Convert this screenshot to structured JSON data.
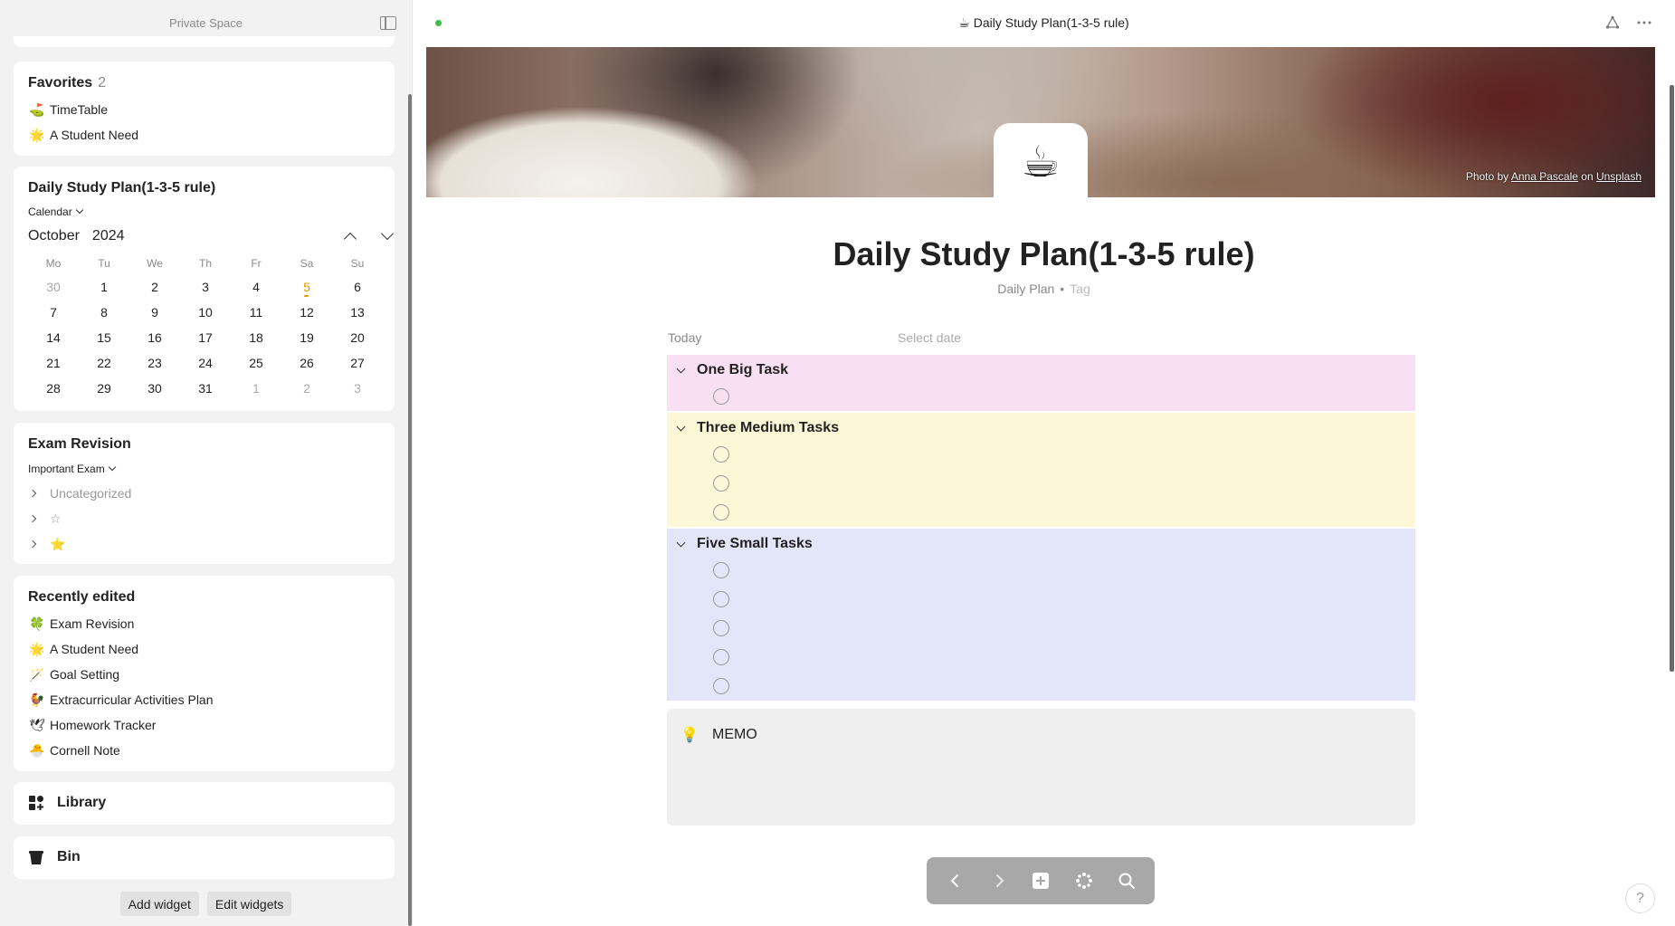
{
  "sidebar": {
    "space_name": "Private Space",
    "favorites": {
      "title": "Favorites",
      "count": "2",
      "items": [
        {
          "emoji": "⛳",
          "label": "TimeTable"
        },
        {
          "emoji": "🌟",
          "label": "A Student Need"
        }
      ]
    },
    "calendar_widget": {
      "title": "Daily Study Plan(1-3-5 rule)",
      "view": "Calendar",
      "month": "October",
      "year": "2024",
      "weekdays": [
        "Mo",
        "Tu",
        "We",
        "Th",
        "Fr",
        "Sa",
        "Su"
      ],
      "weeks": [
        [
          "30",
          "1",
          "2",
          "3",
          "4",
          "5",
          "6"
        ],
        [
          "7",
          "8",
          "9",
          "10",
          "11",
          "12",
          "13"
        ],
        [
          "14",
          "15",
          "16",
          "17",
          "18",
          "19",
          "20"
        ],
        [
          "21",
          "22",
          "23",
          "24",
          "25",
          "26",
          "27"
        ],
        [
          "28",
          "29",
          "30",
          "31",
          "1",
          "2",
          "3"
        ]
      ],
      "today": "5"
    },
    "exam_widget": {
      "title": "Exam Revision",
      "group_by": "Important Exam",
      "groups": [
        {
          "label": "Uncategorized"
        },
        {
          "label": "☆"
        },
        {
          "label": "⭐"
        }
      ]
    },
    "recent": {
      "title": "Recently edited",
      "items": [
        {
          "emoji": "🍀",
          "label": "Exam Revision"
        },
        {
          "emoji": "🌟",
          "label": "A Student Need"
        },
        {
          "emoji": "🪄",
          "label": "Goal Setting"
        },
        {
          "emoji": "🐓",
          "label": "Extracurricular Activities Plan"
        },
        {
          "emoji": "🕊",
          "label": "Homework Tracker"
        },
        {
          "emoji": "🐣",
          "label": "Cornell Note"
        }
      ]
    },
    "library_label": "Library",
    "bin_label": "Bin",
    "add_widget_label": "Add widget",
    "edit_widgets_label": "Edit widgets"
  },
  "main": {
    "top_title": "☕ Daily Study Plan(1-3-5 rule)",
    "page_icon": "☕",
    "credit": {
      "prefix": "Photo by",
      "author": "Anna Pascale",
      "mid": "on",
      "site": "Unsplash"
    },
    "title": "Daily Study Plan(1-3-5 rule)",
    "type": "Daily Plan",
    "tag_placeholder": "Tag",
    "date_label": "Today",
    "date_placeholder": "Select date",
    "sections": [
      {
        "title": "One Big Task",
        "count": 1
      },
      {
        "title": "Three Medium Tasks",
        "count": 3
      },
      {
        "title": "Five Small Tasks",
        "count": 5
      }
    ],
    "memo_icon": "💡",
    "memo_label": "MEMO",
    "help": "?"
  },
  "colors": {
    "pink": "#f8dff1",
    "yellow": "#fcf7d6",
    "blue": "#e3e6f9",
    "today": "#e39b00",
    "status": "#3ac14a"
  }
}
